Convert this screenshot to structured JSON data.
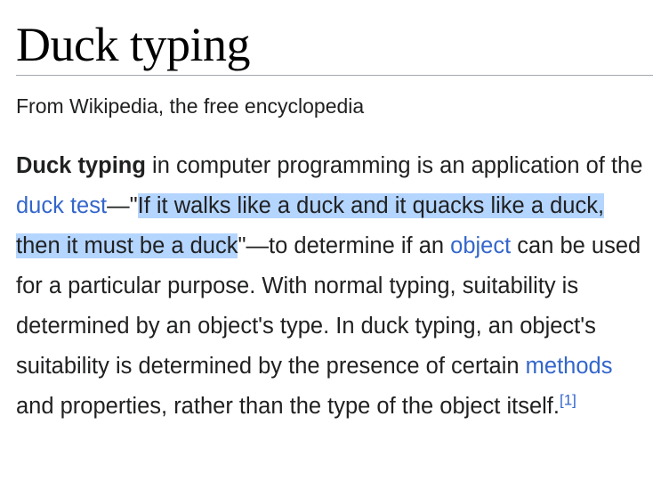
{
  "article": {
    "title": "Duck typing",
    "tagline": "From Wikipedia, the free encyclopedia"
  },
  "paragraph": {
    "term": "Duck typing",
    "text1": " in computer programming is an application of the ",
    "link_duck_test": "duck test",
    "dash_open": "—\"",
    "quote_highlighted": "If it walks like a duck and it quacks like a duck, then it must be a duck",
    "dash_close": "\"—to determine if an ",
    "link_object": "object",
    "text2": " can be used for a particular purpose. With normal typing, suitability is determined by an object's type. In duck typing, an object's suitability is determined by the presence of certain ",
    "link_methods": "methods",
    "text3": " and properties, rather than the type of the object itself.",
    "reference": "[1]"
  },
  "colors": {
    "link": "#3366cc",
    "text": "#202122",
    "selection_highlight": "#b4d5fe",
    "title_rule": "#a2a9b1"
  }
}
